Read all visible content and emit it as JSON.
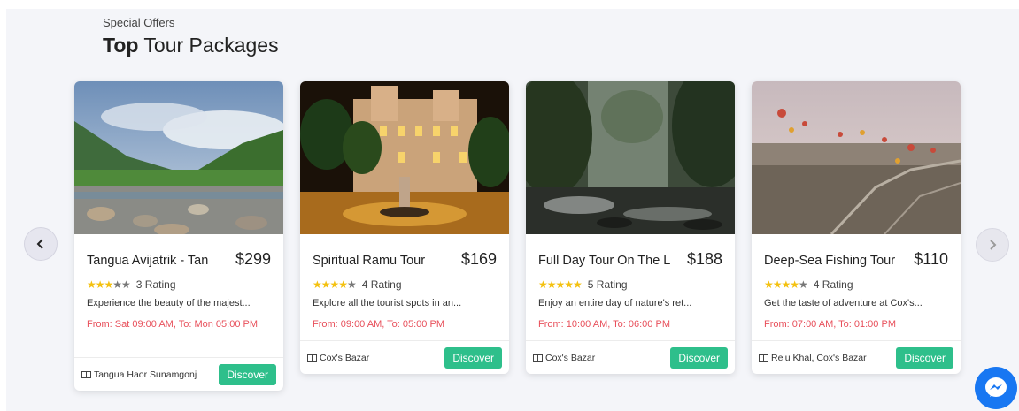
{
  "section": {
    "eyebrow": "Special Offers",
    "heading_bold": "Top",
    "heading_rest": " Tour Packages"
  },
  "carousel": {
    "prev_icon": "chevron-left-icon",
    "next_icon": "chevron-right-icon"
  },
  "cards": [
    {
      "title": "Tangua Avijatrik - Tan",
      "price": "$299",
      "stars_on": 3,
      "rating_text": "3 Rating",
      "description": "Experience the beauty of the majest...",
      "time": "From: Sat 09:00 AM, To: Mon 05:00 PM",
      "location": "Tangua Haor Sunamgonj",
      "button": "Discover"
    },
    {
      "title": "Spiritual Ramu Tour",
      "price": "$169",
      "stars_on": 4,
      "rating_text": "4 Rating",
      "description": "Explore all the tourist spots in an...",
      "time": "From: 09:00 AM, To: 05:00 PM",
      "location": "Cox's Bazar",
      "button": "Discover"
    },
    {
      "title": "Full Day Tour On The L",
      "price": "$188",
      "stars_on": 5,
      "rating_text": "5 Rating",
      "description": "Enjoy an entire day of nature's ret...",
      "time": "From: 10:00 AM, To: 06:00 PM",
      "location": "Cox's Bazar",
      "button": "Discover"
    },
    {
      "title": "Deep-Sea Fishing Tour",
      "price": "$110",
      "stars_on": 4,
      "rating_text": "4 Rating",
      "description": "Get the taste of adventure at Cox's...",
      "time": "From: 07:00 AM, To: 01:00 PM",
      "location": "Reju Khal, Cox's Bazar",
      "button": "Discover"
    }
  ],
  "colors": {
    "accent_green": "#2ebf8b",
    "time_red": "#e8505b",
    "star_yellow": "#f4c10f",
    "messenger_blue": "#1877f2"
  }
}
